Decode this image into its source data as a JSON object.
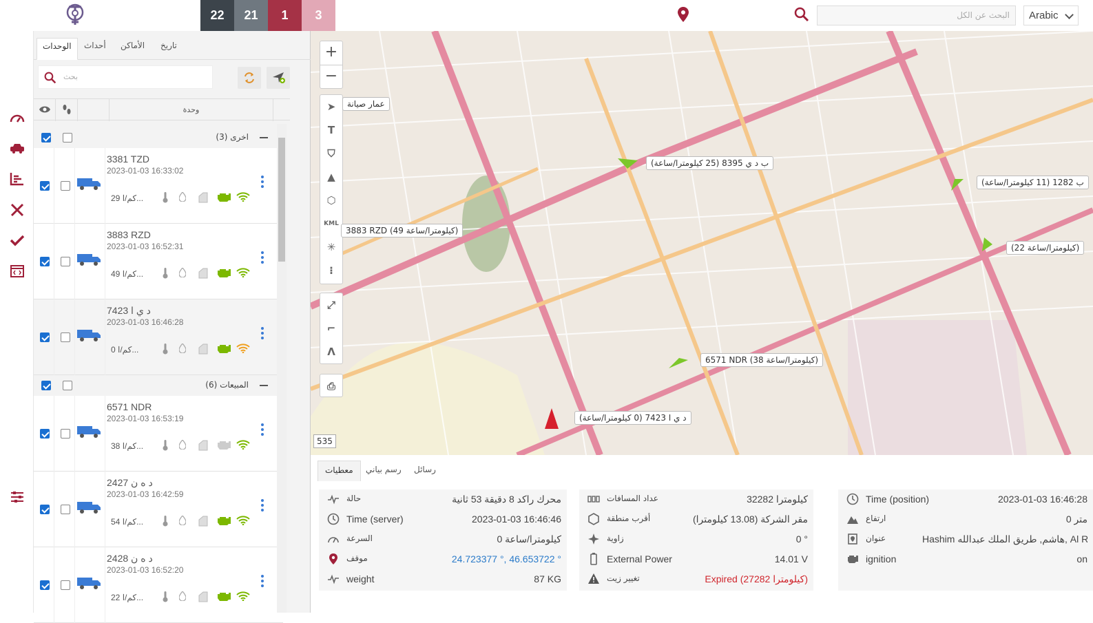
{
  "topbar": {
    "counters": [
      {
        "value": "22",
        "color": "#3c444b"
      },
      {
        "value": "21",
        "color": "#6f7880"
      },
      {
        "value": "1",
        "color": "#a53246"
      },
      {
        "value": "3",
        "color": "#e2a8b6"
      }
    ],
    "search_placeholder": "البحث عن الكل",
    "language": "Arabic"
  },
  "panel": {
    "tabs": [
      "الوحدات",
      "أحداث",
      "الأماكن",
      "تاريخ"
    ],
    "search_placeholder": "بحث",
    "header_unit": "وحدة",
    "groups": [
      {
        "label": "(3) اخرى",
        "units": [
          {
            "name": "3381 TZD",
            "time": "2023-01-03 16:33:02",
            "speed": "29 كم/ا...",
            "engine_color": "#7cb800",
            "signal_color": "#7cb800"
          },
          {
            "name": "3883 RZD",
            "time": "2023-01-03 16:52:31",
            "speed": "49 كم/ا...",
            "engine_color": "#7cb800",
            "signal_color": "#7cb800"
          },
          {
            "name": "7423 د ي ا",
            "time": "2023-01-03 16:46:28",
            "speed": "0 كم/ا...",
            "engine_color": "#7cb800",
            "signal_color": "#f0a020"
          }
        ]
      },
      {
        "label": "(6) المبيعات",
        "units": [
          {
            "name": "6571 NDR",
            "time": "2023-01-03 16:53:19",
            "speed": "38 كم/ا...",
            "engine_color": "#cccccc",
            "signal_color": "#7cb800"
          },
          {
            "name": "2427 د ه ن",
            "time": "2023-01-03 16:42:59",
            "speed": "54 كم/ا...",
            "engine_color": "#7cb800",
            "signal_color": "#7cb800"
          },
          {
            "name": "2428 د ه ن",
            "time": "2023-01-03 16:52:20",
            "speed": "22 كم/ا...",
            "engine_color": "#7cb800",
            "signal_color": "#7cb800"
          }
        ]
      }
    ]
  },
  "map": {
    "labels": [
      {
        "text": "عمار صيانة"
      },
      {
        "text": "ب د ي 8395 (25 كيلومترا/ساعة)"
      },
      {
        "text": "3883 RZD (49 كيلومترا/ساعة)"
      },
      {
        "text": "ب 1282 (11 كيلومترا/ساعة)"
      },
      {
        "text": "(22 كيلومترا/ساعة)"
      },
      {
        "text": "6571 NDR (38 كيلومترا/ساعة)"
      },
      {
        "text": "د ي ا 7423 (0 كيلومترا/ساعة)"
      }
    ],
    "badge": "535",
    "tool_kml": "KML"
  },
  "details": {
    "tabs": [
      "معطيات",
      "رسم بياني",
      "رسائل"
    ],
    "col1": [
      {
        "label": "حالة",
        "value": "محرك راكد 8 دقيقة 53 ثانية",
        "icon": "pulse-icon"
      },
      {
        "label": "Time (server)",
        "value": "2023-01-03 16:46:46",
        "icon": "clock-icon"
      },
      {
        "label": "السرعة",
        "value": "0 كيلومترا/ساعة",
        "icon": "speedometer-icon"
      },
      {
        "label": "موقف",
        "value": "24.723377 °, 46.653722 °",
        "icon": "pin-icon"
      },
      {
        "label": "weight",
        "value": "87 KG",
        "icon": "pulse-icon"
      }
    ],
    "col2": [
      {
        "label": "عداد المسافات",
        "value": "32282 كيلومترا",
        "icon": "odometer-icon"
      },
      {
        "label": "أقرب منطقة",
        "value": "مقر الشركة (13.08 كيلومترا)",
        "icon": "zone-icon"
      },
      {
        "label": "زاوية",
        "value": "0 °",
        "icon": "angle-icon"
      },
      {
        "label": "External Power",
        "value": "14.01 V",
        "icon": "battery-icon"
      },
      {
        "label": "تغيير زيت",
        "value": "Expired (27282 كيلومترا)",
        "icon": "warning-icon"
      }
    ],
    "col3": [
      {
        "label": "Time (position)",
        "value": "2023-01-03 16:46:28",
        "icon": "clock-icon"
      },
      {
        "label": "ارتفاع",
        "value": "0 متر",
        "icon": "altitude-icon"
      },
      {
        "label": "عنوان",
        "value": "Hashim هاشم, طريق الملك عبدالله, Al R...",
        "icon": "address-icon"
      },
      {
        "label": "ignition",
        "value": "on",
        "icon": "engine-icon"
      }
    ]
  }
}
